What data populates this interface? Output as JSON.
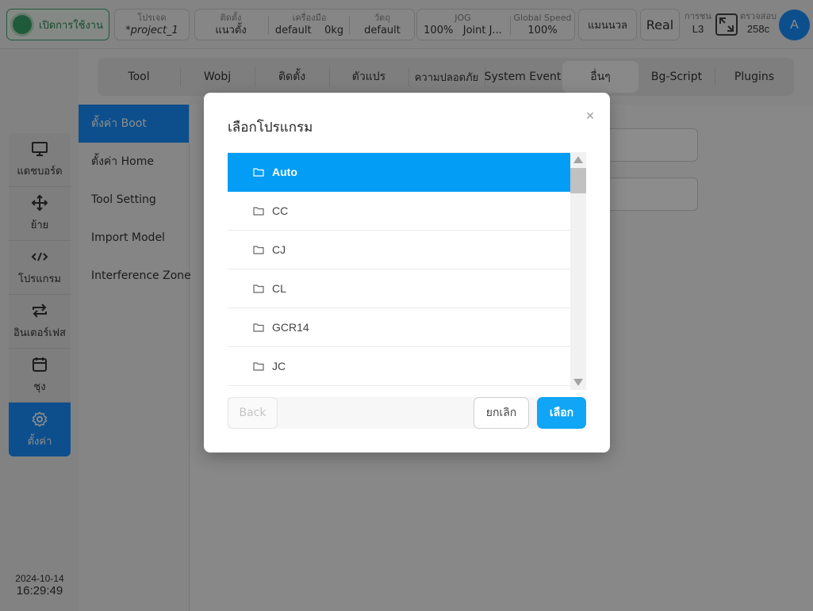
{
  "topbar": {
    "power_label": "เปิดการใช้งาน",
    "project": {
      "title": "โปรเจค",
      "value": "*project_1"
    },
    "install": {
      "title": "ติดตั้ง",
      "value": "แนวตั้ง"
    },
    "tool": {
      "title": "เครื่องมือ",
      "value": "default",
      "weight": "0kg"
    },
    "workpiece": {
      "title": "วัตถุ",
      "value": "default"
    },
    "jog": {
      "title": "JOG",
      "value": "100%",
      "mode": "Joint J..."
    },
    "global_speed": {
      "title": "Global Speed",
      "value": "100%"
    },
    "manual_label": "แมนนวล",
    "real_label": "Real",
    "collision": {
      "title": "การชน",
      "value": "L3"
    },
    "check": {
      "title": "ตรวจสอบ",
      "value": "258c"
    },
    "avatar_letter": "A"
  },
  "leftnav": {
    "items": [
      {
        "label": "แดชบอร์ด",
        "icon": "monitor-icon"
      },
      {
        "label": "ย้าย",
        "icon": "move-icon"
      },
      {
        "label": "โปรแกรม",
        "icon": "code-icon"
      },
      {
        "label": "อินเตอร์เฟส",
        "icon": "interface-icon"
      },
      {
        "label": "ชุง",
        "icon": "calendar-icon"
      },
      {
        "label": "ตั้งค่า",
        "icon": "gear-icon"
      }
    ],
    "date": "2024-10-14",
    "time": "16:29:49"
  },
  "tabs": [
    "Tool",
    "Wobj",
    "ติดตั้ง",
    "ตัวแปร",
    "ความปลอดภัย",
    "System Event",
    "อื่นๆ",
    "Bg-Script",
    "Plugins"
  ],
  "submenu": [
    "ตั้งค่า Boot",
    "ตั้งค่า Home",
    "Tool Setting",
    "Import Model",
    "Interference Zone"
  ],
  "modal": {
    "title": "เลือกโปรแกรม",
    "folders": [
      "Auto",
      "CC",
      "CJ",
      "CL",
      "GCR14",
      "JC"
    ],
    "selected": "Auto",
    "back_label": "Back",
    "cancel_label": "ยกเลิก",
    "ok_label": "เลือก"
  },
  "colors": {
    "accent": "#1890ff",
    "selected_row": "#039df5",
    "power_green": "#3aa56c"
  }
}
